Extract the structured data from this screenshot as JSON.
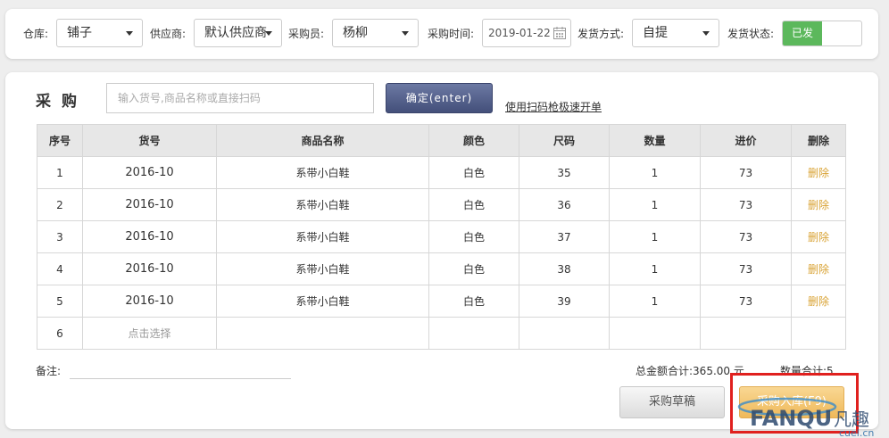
{
  "filters": {
    "warehouse_label": "仓库:",
    "warehouse_value": "铺子",
    "supplier_label": "供应商:",
    "supplier_value": "默认供应商",
    "buyer_label": "采购员:",
    "buyer_value": "杨柳",
    "purchase_time_label": "采购时间:",
    "purchase_time_value": "2019-01-22",
    "ship_method_label": "发货方式:",
    "ship_method_value": "自提",
    "ship_status_label": "发货状态:",
    "ship_status_value": "已发"
  },
  "purchase": {
    "title": "采购",
    "search_placeholder": "输入货号,商品名称或直接扫码",
    "confirm_label": "确定(enter)",
    "scan_link": "使用扫码枪极速开单"
  },
  "table": {
    "headers": [
      "序号",
      "货号",
      "商品名称",
      "颜色",
      "尺码",
      "数量",
      "进价",
      "删除"
    ],
    "rows": [
      {
        "no": "1",
        "code": "2016-10",
        "name": "系带小白鞋",
        "color": "白色",
        "size": "35",
        "qty": "1",
        "price": "73",
        "action": "删除"
      },
      {
        "no": "2",
        "code": "2016-10",
        "name": "系带小白鞋",
        "color": "白色",
        "size": "36",
        "qty": "1",
        "price": "73",
        "action": "删除"
      },
      {
        "no": "3",
        "code": "2016-10",
        "name": "系带小白鞋",
        "color": "白色",
        "size": "37",
        "qty": "1",
        "price": "73",
        "action": "删除"
      },
      {
        "no": "4",
        "code": "2016-10",
        "name": "系带小白鞋",
        "color": "白色",
        "size": "38",
        "qty": "1",
        "price": "73",
        "action": "删除"
      },
      {
        "no": "5",
        "code": "2016-10",
        "name": "系带小白鞋",
        "color": "白色",
        "size": "39",
        "qty": "1",
        "price": "73",
        "action": "删除"
      }
    ],
    "new_row_no": "6",
    "new_row_pick": "点击选择"
  },
  "footer": {
    "remark_label": "备注:",
    "total_amount": "总金额合计:365.00 元",
    "total_qty": "数量合计:5",
    "draft_button": "采购草稿",
    "submit_button": "采购入库(F9)"
  },
  "watermark": {
    "text": "FANQU凡趣",
    "domain": "cuel.cn"
  },
  "colors": {
    "toggle_on": "#5cb85c",
    "confirm_button": "#4d5986",
    "delete_link": "#d9a335",
    "submit_button": "#f0bd62",
    "highlight_box": "#e0201e"
  }
}
